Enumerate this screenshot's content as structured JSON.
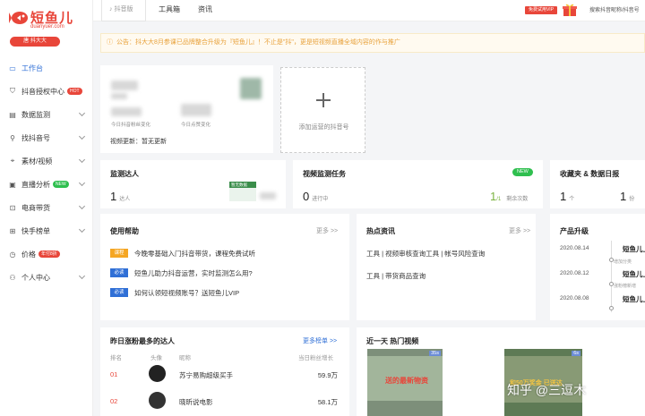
{
  "brand": {
    "name": "短鱼儿",
    "domain": "duanyuer.com",
    "user": "唐 抖大大"
  },
  "nav": [
    {
      "label": "工作台",
      "icon": "monitor-icon",
      "active": true
    },
    {
      "label": "抖音授权中心",
      "icon": "shield-icon",
      "badge": "HOT"
    },
    {
      "label": "数据监测",
      "icon": "chart-icon",
      "chev": true
    },
    {
      "label": "找抖音号",
      "icon": "search-user-icon",
      "chev": true
    },
    {
      "label": "素材/视频",
      "icon": "location-icon",
      "chev": true
    },
    {
      "label": "直播分析",
      "icon": "live-icon",
      "badge": "NEW",
      "chev": true
    },
    {
      "label": "电商带货",
      "icon": "cart-icon",
      "chev": true
    },
    {
      "label": "快手榜单",
      "icon": "kuaishou-icon",
      "chev": true
    },
    {
      "label": "价格",
      "icon": "price-icon",
      "badge": "年付8折"
    },
    {
      "label": "个人中心",
      "icon": "user-icon",
      "chev": true
    }
  ],
  "topbar": {
    "douyin_tab": "抖音版",
    "tools": "工具箱",
    "news": "资讯",
    "vip": "免费试用VIP",
    "search": "搜索抖音昵称/抖音号"
  },
  "notice": "公告：抖大大8月参课已品牌整合升级为『短鱼儿』！不止是\"抖\"，更是短视频直播全域内容的作与推广",
  "account": {
    "label_followers": "今日抖音粉丝变化",
    "label_likes": "今日点赞变化",
    "video_update": "视频更新：暂无更新",
    "add_label": "添加运营的抖音号"
  },
  "stats": {
    "monitor": {
      "title": "监测达人",
      "value": "1",
      "unit": "达人",
      "side": "暂无数据"
    },
    "video": {
      "title": "视频监测任务",
      "value": "0",
      "unit": "进行中",
      "badge": "NEW",
      "right_value": "1",
      "right_unit": "/1",
      "right_label": "剩余次数"
    },
    "fav": {
      "title": "收藏夹 & 数据日报",
      "value1": "1",
      "unit1": "个",
      "value2": "1",
      "unit2": "份"
    }
  },
  "help": {
    "title": "使用帮助",
    "more": "更多 >>",
    "items": [
      {
        "tag": "课程",
        "tag_color": "orange",
        "text": "今晚零基础入门抖音带货，课程免费试听"
      },
      {
        "tag": "必读",
        "tag_color": "blue",
        "text": "短鱼儿助力抖音运营，实时监测怎么用?"
      },
      {
        "tag": "必读",
        "tag_color": "blue",
        "text": "如何认领短视频账号？送短鱼儿VIP"
      }
    ]
  },
  "hotnews": {
    "title": "热点资讯",
    "more": "更多 >>",
    "items": [
      "工具 | 视频审核查询工具 | 帐号风险查询",
      "工具 | 带货商品查询"
    ]
  },
  "updates": {
    "title": "产品升级",
    "items": [
      {
        "date": "2020.08.14",
        "text": "短鱼儿上线",
        "sub": "增加分类"
      },
      {
        "date": "2020.08.12",
        "text": "短鱼儿上线",
        "sub": "涨粉榜新增"
      },
      {
        "date": "2020.08.08",
        "text": "短鱼儿上线"
      }
    ]
  },
  "ranking": {
    "title": "昨日涨粉最多的达人",
    "more": "更多榜单 >>",
    "cols": {
      "rank": "排名",
      "avatar": "头像",
      "name": "昵称",
      "growth": "当日粉丝增长"
    },
    "rows": [
      {
        "rank": "01",
        "name": "苏宁易购超级买手",
        "growth": "59.9万"
      },
      {
        "rank": "02",
        "name": "晓昕说电影",
        "growth": "58.1万"
      }
    ]
  },
  "hotvideo": {
    "title": "近一天 热门视频",
    "videos": [
      {
        "duration": "35s",
        "caption": "送的最新物资"
      },
      {
        "duration": "6s",
        "caption": "和50万奖金 已送达"
      }
    ]
  },
  "watermark": "知乎 @三逗木",
  "colors": {
    "brand_red": "#e8463a",
    "link_blue": "#2f6fd6",
    "new_green": "#2fbf4f",
    "tag_orange": "#f5a623",
    "notice_text": "#e8a13a"
  }
}
